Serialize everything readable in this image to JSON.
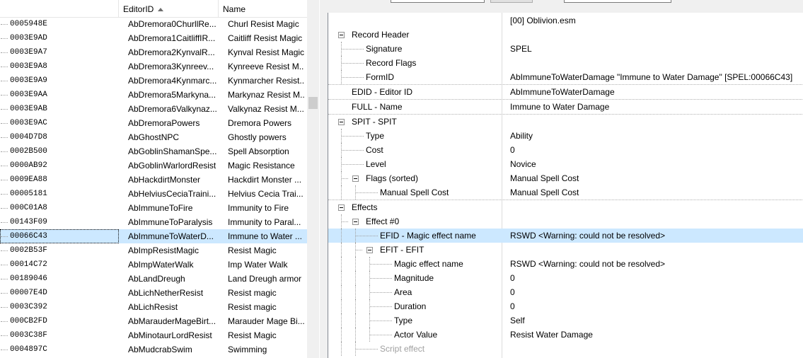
{
  "left_list": {
    "columns": {
      "formid": "",
      "editorid": "EditorID",
      "name": "Name"
    },
    "rows": [
      {
        "formid": "0005948E",
        "editorid": "AbDremora0ChurllRe...",
        "name": "Churl Resist Magic"
      },
      {
        "formid": "0003E9AD",
        "editorid": "AbDremora1CaitliffIR...",
        "name": "Caitliff Resist Magic"
      },
      {
        "formid": "0003E9A7",
        "editorid": "AbDremora2KynvalR...",
        "name": "Kynval Resist Magic"
      },
      {
        "formid": "0003E9A8",
        "editorid": "AbDremora3Kynreev...",
        "name": "Kynreeve Resist M..."
      },
      {
        "formid": "0003E9A9",
        "editorid": "AbDremora4Kynmarc...",
        "name": "Kynmarcher Resist..."
      },
      {
        "formid": "0003E9AA",
        "editorid": "AbDremora5Markyna...",
        "name": "Markynaz Resist M..."
      },
      {
        "formid": "0003E9AB",
        "editorid": "AbDremora6Valkynaz...",
        "name": "Valkynaz Resist M..."
      },
      {
        "formid": "0003E9AC",
        "editorid": "AbDremoraPowers",
        "name": "Dremora Powers"
      },
      {
        "formid": "0004D7D8",
        "editorid": "AbGhostNPC",
        "name": "Ghostly powers"
      },
      {
        "formid": "0002B500",
        "editorid": "AbGoblinShamanSpe...",
        "name": "Spell Absorption"
      },
      {
        "formid": "0000AB92",
        "editorid": "AbGoblinWarlordResist",
        "name": "Magic Resistance"
      },
      {
        "formid": "0009EA88",
        "editorid": "AbHackdirtMonster",
        "name": "Hackdirt Monster ..."
      },
      {
        "formid": "00005181",
        "editorid": "AbHelviusCeciaTraini...",
        "name": "Helvius Cecia Trai..."
      },
      {
        "formid": "000C01A8",
        "editorid": "AbImmuneToFire",
        "name": "Immunity to Fire"
      },
      {
        "formid": "00143F09",
        "editorid": "AbImmuneToParalysis",
        "name": "Immunity to Paral..."
      },
      {
        "formid": "00066C43",
        "editorid": "AbImmuneToWaterD...",
        "name": "Immune to Water ...",
        "selected": true
      },
      {
        "formid": "0002B53F",
        "editorid": "AbImpResistMagic",
        "name": "Resist Magic"
      },
      {
        "formid": "00014C72",
        "editorid": "AbImpWaterWalk",
        "name": "Imp Water Walk"
      },
      {
        "formid": "00189046",
        "editorid": "AbLandDreugh",
        "name": "Land Dreugh armor"
      },
      {
        "formid": "00007E4D",
        "editorid": "AbLichNetherResist",
        "name": "Resist magic"
      },
      {
        "formid": "0003C392",
        "editorid": "AbLichResist",
        "name": "Resist magic"
      },
      {
        "formid": "000CB2FD",
        "editorid": "AbMarauderMageBirt...",
        "name": "Marauder Mage Bi..."
      },
      {
        "formid": "0003C38F",
        "editorid": "AbMinotaurLordResist",
        "name": "Resist Magic"
      },
      {
        "formid": "0004897C",
        "editorid": "AbMudcrabSwim",
        "name": "Swimming"
      }
    ]
  },
  "record_view": {
    "file_header": "[00] Oblivion.esm",
    "rows": [
      {
        "label": "Record Header",
        "value": "",
        "level": 0,
        "expander": true
      },
      {
        "label": "Signature",
        "value": "SPEL",
        "level": 1
      },
      {
        "label": "Record Flags",
        "value": "",
        "level": 1
      },
      {
        "label": "FormID",
        "value": "AbImmuneToWaterDamage \"Immune to Water Damage\" [SPEL:00066C43]",
        "level": 1
      },
      {
        "label": "EDID - Editor ID",
        "value": "AbImmuneToWaterDamage",
        "level": 0,
        "sep": true
      },
      {
        "label": "FULL - Name",
        "value": "Immune to Water Damage",
        "level": 0,
        "sep": true
      },
      {
        "label": "SPIT - SPIT",
        "value": "",
        "level": 0,
        "expander": true,
        "sep": true
      },
      {
        "label": "Type",
        "value": "Ability",
        "level": 1
      },
      {
        "label": "Cost",
        "value": "0",
        "level": 1
      },
      {
        "label": "Level",
        "value": "Novice",
        "level": 1
      },
      {
        "label": "Flags (sorted)",
        "value": "Manual Spell Cost",
        "level": 1,
        "expander": true
      },
      {
        "label": "Manual Spell Cost",
        "value": "Manual Spell Cost",
        "level": 2
      },
      {
        "label": "Effects",
        "value": "",
        "level": 0,
        "expander": true,
        "sep": true
      },
      {
        "label": "Effect #0",
        "value": "",
        "level": 1,
        "expander": true
      },
      {
        "label": "EFID - Magic effect name",
        "value": "RSWD <Warning: could not be resolved>",
        "level": 2,
        "selected": true
      },
      {
        "label": "EFIT - EFIT",
        "value": "",
        "level": 2,
        "expander": true
      },
      {
        "label": "Magic effect name",
        "value": "RSWD <Warning: could not be resolved>",
        "level": 3
      },
      {
        "label": "Magnitude",
        "value": "0",
        "level": 3
      },
      {
        "label": "Area",
        "value": "0",
        "level": 3
      },
      {
        "label": "Duration",
        "value": "0",
        "level": 3
      },
      {
        "label": "Type",
        "value": "Self",
        "level": 3
      },
      {
        "label": "Actor Value",
        "value": "Resist Water Damage",
        "level": 3
      },
      {
        "label": "Script effect",
        "value": "",
        "level": 2,
        "dim": true
      }
    ]
  },
  "colors": {
    "selection": "#cce8ff",
    "panel_bg": "#f0f0f0"
  }
}
